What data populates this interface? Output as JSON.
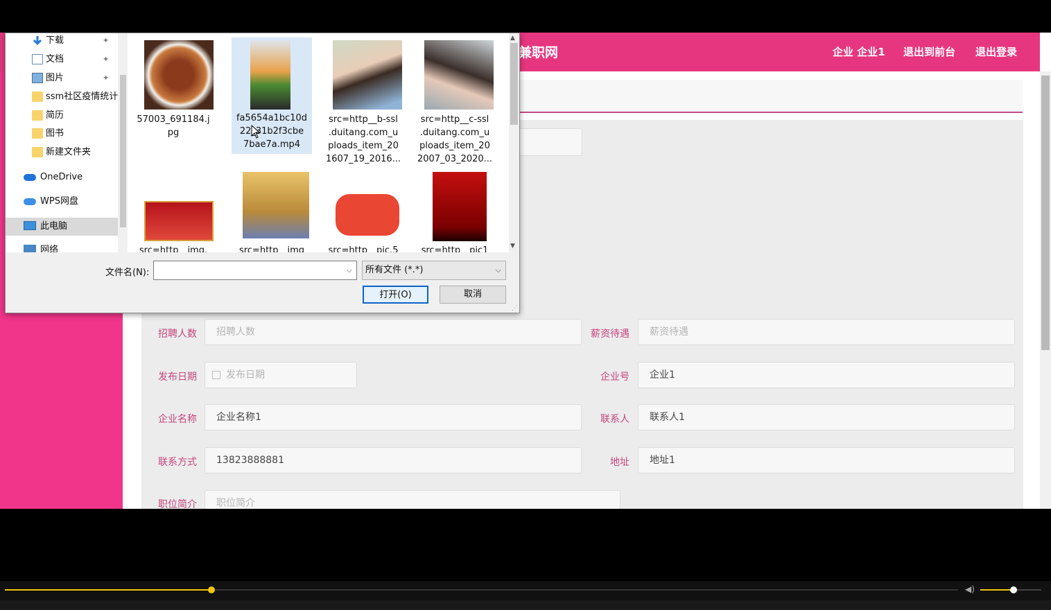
{
  "site": {
    "brand": "兼职网",
    "nav": [
      "企业 企业1",
      "退出到前台",
      "退出登录"
    ]
  },
  "form": {
    "fields": [
      {
        "label": "招聘人数",
        "value": "",
        "placeholder": "招聘人数"
      },
      {
        "label": "薪资待遇",
        "value": "",
        "placeholder": "薪资待遇"
      },
      {
        "label": "发布日期",
        "value": "",
        "placeholder": "发布日期"
      },
      {
        "label": "企业号",
        "value": "企业1",
        "placeholder": ""
      },
      {
        "label": "企业名称",
        "value": "企业名称1",
        "placeholder": ""
      },
      {
        "label": "联系人",
        "value": "联系人1",
        "placeholder": ""
      },
      {
        "label": "联系方式",
        "value": "13823888881",
        "placeholder": ""
      },
      {
        "label": "地址",
        "value": "地址1",
        "placeholder": ""
      },
      {
        "label": "职位简介",
        "value": "",
        "placeholder": "职位简介"
      }
    ]
  },
  "dialog": {
    "nav": [
      {
        "label": "下载",
        "icon": "download-icon",
        "pinned": true
      },
      {
        "label": "文档",
        "icon": "document-icon",
        "pinned": true
      },
      {
        "label": "图片",
        "icon": "picture-icon",
        "pinned": true
      },
      {
        "label": "ssm社区疫情统计",
        "icon": "folder-icon",
        "pinned": false
      },
      {
        "label": "简历",
        "icon": "folder-icon",
        "pinned": false
      },
      {
        "label": "图书",
        "icon": "folder-icon",
        "pinned": false
      },
      {
        "label": "新建文件夹",
        "icon": "folder-icon",
        "pinned": false
      },
      {
        "label": "OneDrive",
        "icon": "cloud-icon",
        "pinned": false
      },
      {
        "label": "WPS网盘",
        "icon": "cloud-icon",
        "pinned": false
      },
      {
        "label": "此电脑",
        "icon": "computer-icon",
        "pinned": false
      },
      {
        "label": "网络",
        "icon": "network-icon",
        "pinned": false
      }
    ],
    "files": [
      {
        "name": "57003_691184.jpg",
        "lines": [
          "57003_691184.j",
          "pg"
        ]
      },
      {
        "name": "fa5654a1bc10d223_31b2f3cbe7bae7a.mp4",
        "lines": [
          "fa5654a1bc10d",
          "22_31b2f3cbe",
          "7bae7a.mp4"
        ]
      },
      {
        "name": "src=http__b-ssl.duitang.com_uploads_item_201607_19_2016...",
        "lines": [
          "src=http__b-ssl",
          ".duitang.com_u",
          "ploads_item_20",
          "1607_19_2016..."
        ]
      },
      {
        "name": "src=http__c-ssl.duitang.com_uploads_item_202007_03_2020...",
        "lines": [
          "src=http__c-ssl",
          ".duitang.com_u",
          "ploads_item_20",
          "2007_03_2020..."
        ]
      },
      {
        "name": "src=http__img...",
        "lines": [
          "src=http__img."
        ]
      },
      {
        "name": "src=http__img",
        "lines": [
          "src=http__img"
        ]
      },
      {
        "name": "src=http__pic.5",
        "lines": [
          "src=http__pic.5"
        ]
      },
      {
        "name": "src=http__pic1",
        "lines": [
          "src=http__pic1"
        ]
      }
    ],
    "filename_label": "文件名(N):",
    "filename_value": "",
    "filter": "所有文件 (*.*)",
    "open_button": "打开(O)",
    "cancel_button": "取消"
  },
  "player": {
    "progress": 0.217,
    "volume": 0.55
  }
}
